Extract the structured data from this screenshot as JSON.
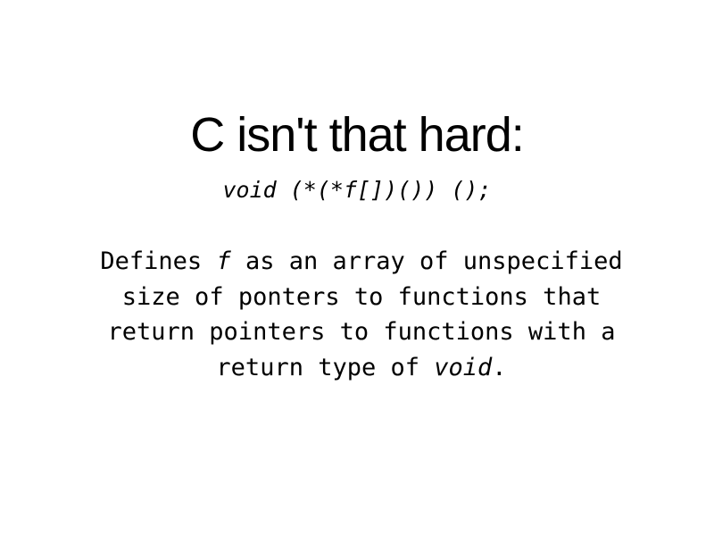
{
  "slide": {
    "title": "C isn't that hard:",
    "code": "void (*(*f[])()) ();",
    "description": {
      "part1": "Defines ",
      "ident_f": "f",
      "part2": " as an array of unspecified size of ponters to functions that return pointers to functions with a return type of ",
      "ident_void": "void",
      "part3": "."
    }
  }
}
